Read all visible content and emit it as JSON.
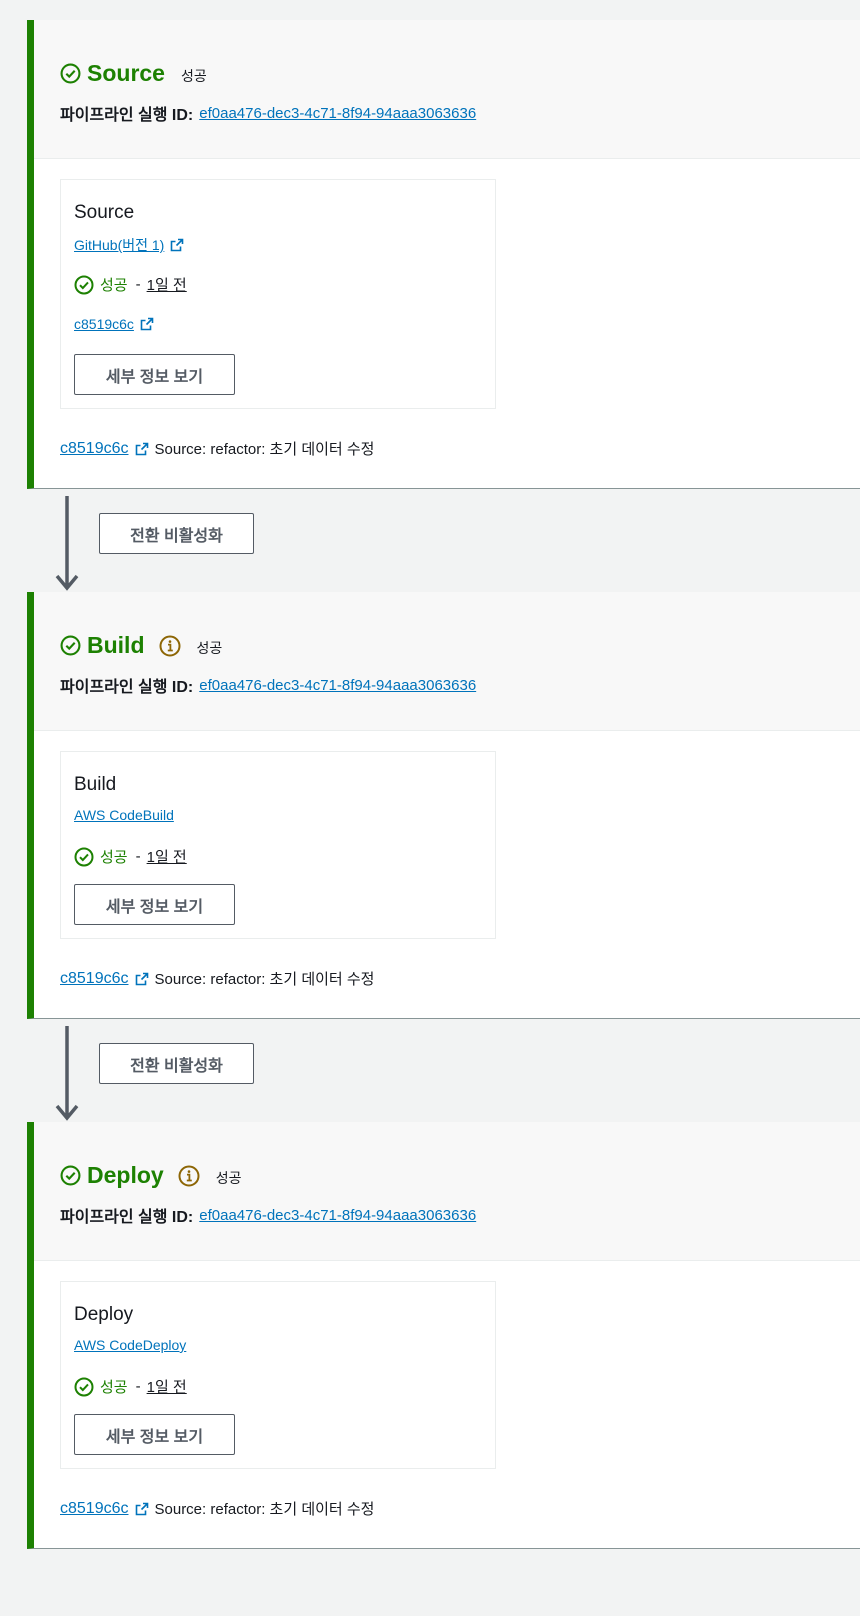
{
  "transition_button_label": "전환 비활성화",
  "stages": [
    {
      "name": "Source",
      "status": "성공",
      "has_info": false,
      "exec_label": "파이프라인 실행 ID:",
      "exec_id": "ef0aa476-dec3-4c71-8f94-94aaa3063636",
      "action": {
        "name": "Source",
        "provider": "GitHub(버전 1)",
        "provider_external": true,
        "status": "성공",
        "separator": "-",
        "time": "1일 전",
        "commit": "c8519c6c",
        "details_label": "세부 정보 보기"
      },
      "footer": {
        "commit": "c8519c6c",
        "message": "Source: refactor: 초기 데이터 수정"
      }
    },
    {
      "name": "Build",
      "status": "성공",
      "has_info": true,
      "exec_label": "파이프라인 실행 ID:",
      "exec_id": "ef0aa476-dec3-4c71-8f94-94aaa3063636",
      "action": {
        "name": "Build",
        "provider": "AWS CodeBuild",
        "provider_external": false,
        "status": "성공",
        "separator": "-",
        "time": "1일 전",
        "details_label": "세부 정보 보기"
      },
      "footer": {
        "commit": "c8519c6c",
        "message": "Source: refactor: 초기 데이터 수정"
      }
    },
    {
      "name": "Deploy",
      "status": "성공",
      "has_info": true,
      "exec_label": "파이프라인 실행 ID:",
      "exec_id": "ef0aa476-dec3-4c71-8f94-94aaa3063636",
      "action": {
        "name": "Deploy",
        "provider": "AWS CodeDeploy",
        "provider_external": false,
        "status": "성공",
        "separator": "-",
        "time": "1일 전",
        "details_label": "세부 정보 보기"
      },
      "footer": {
        "commit": "c8519c6c",
        "message": "Source: refactor: 초기 데이터 수정"
      }
    }
  ],
  "colors": {
    "success": "#1d8102",
    "link": "#0073bb",
    "info": "#8d6605",
    "border": "#545b64"
  },
  "icons": [
    "status-success-icon",
    "info-icon",
    "external-link-icon",
    "arrow-down-icon"
  ]
}
